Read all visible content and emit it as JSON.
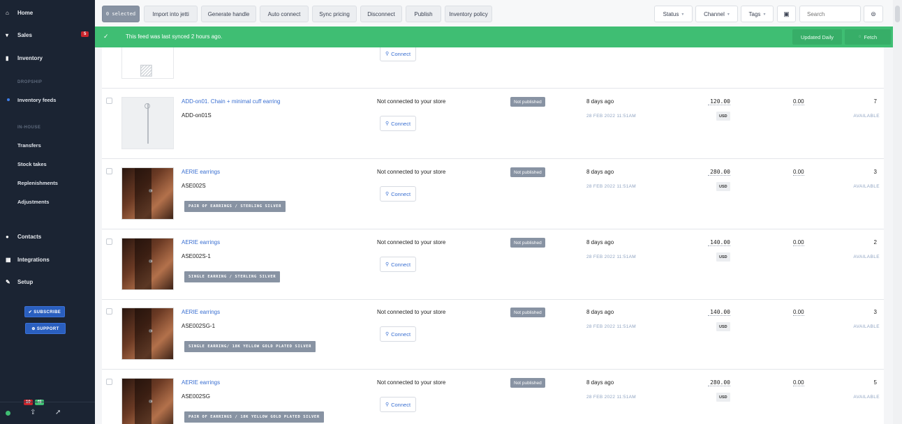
{
  "sidebar": {
    "nav": [
      {
        "label": "Home",
        "icon": "home-icon"
      },
      {
        "label": "Sales",
        "icon": "cart-icon",
        "badge": "5"
      },
      {
        "label": "Inventory",
        "icon": "bookmark-icon"
      }
    ],
    "section_dropship": "DROPSHIP",
    "inventory_feeds": "Inventory feeds",
    "section_inhouse": "IN-HOUSE",
    "inhouse_items": [
      "Transfers",
      "Stock takes",
      "Replenishments",
      "Adjustments"
    ],
    "nav2": [
      {
        "label": "Contacts",
        "icon": "contact-icon"
      },
      {
        "label": "Integrations",
        "icon": "grid-icon"
      },
      {
        "label": "Setup",
        "icon": "wrench-icon"
      }
    ],
    "subscribe": "✔ SUBSCRIBE",
    "support": "⊕ SUPPORT",
    "footer_badges": [
      "10",
      "45"
    ]
  },
  "toolbar": {
    "selected": "0 selected",
    "actions": [
      "Import into jetti",
      "Generate handle",
      "Auto connect",
      "Sync pricing",
      "Disconnect",
      "Publish",
      "Inventory policy"
    ],
    "status": "Status",
    "channel": "Channel",
    "tags": "Tags",
    "search_placeholder": "Search"
  },
  "banner": {
    "message": "This feed was last synced 2 hours ago.",
    "updated": "Updated Daily",
    "fetch": "Fetch"
  },
  "rows": [
    {
      "name": "ADD-on01. Chain + minimal cuff earring",
      "sku": "ADD-on01S",
      "tag": "",
      "conn": "Not connected to your store",
      "connect": "Connect",
      "pub": "Not published",
      "ago": "8 days ago",
      "date": "28 FEB 2022 11:51AM",
      "price": "120.00",
      "cur": "USD",
      "cost": "0.00",
      "qty": "7",
      "avail": "AVAILABLE"
    },
    {
      "name": "AERIE earrings",
      "sku": "ASE002S",
      "tag": "PAIR OF EARRINGS / STERLING SILVER",
      "conn": "Not connected to your store",
      "connect": "Connect",
      "pub": "Not published",
      "ago": "8 days ago",
      "date": "28 FEB 2022 11:51AM",
      "price": "280.00",
      "cur": "USD",
      "cost": "0.00",
      "qty": "3",
      "avail": "AVAILABLE"
    },
    {
      "name": "AERIE earrings",
      "sku": "ASE002S-1",
      "tag": "SINGLE EARRING / STERLING SILVER",
      "conn": "Not connected to your store",
      "connect": "Connect",
      "pub": "Not published",
      "ago": "8 days ago",
      "date": "28 FEB 2022 11:51AM",
      "price": "140.00",
      "cur": "USD",
      "cost": "0.00",
      "qty": "2",
      "avail": "AVAILABLE"
    },
    {
      "name": "AERIE earrings",
      "sku": "ASE002SG-1",
      "tag": "SINGLE EARRING/ 18K YELLOW GOLD PLATED SILVER",
      "conn": "Not connected to your store",
      "connect": "Connect",
      "pub": "Not published",
      "ago": "8 days ago",
      "date": "28 FEB 2022 11:51AM",
      "price": "140.00",
      "cur": "USD",
      "cost": "0.00",
      "qty": "3",
      "avail": "AVAILABLE"
    },
    {
      "name": "AERIE earrings",
      "sku": "ASE002SG",
      "tag": "PAIR OF EARRINGS / 18K YELLOW GOLD PLATED SILVER",
      "conn": "Not connected to your store",
      "connect": "Connect",
      "pub": "Not published",
      "ago": "8 days ago",
      "date": "28 FEB 2022 11:51AM",
      "price": "280.00",
      "cur": "USD",
      "cost": "0.00",
      "qty": "5",
      "avail": "AVAILABLE"
    }
  ],
  "first_row_connect": "Connect",
  "colors": {
    "sidebar": "#1b2433",
    "banner": "#3fbe73",
    "link": "#3a6fd1",
    "badge": "#8893a3"
  }
}
